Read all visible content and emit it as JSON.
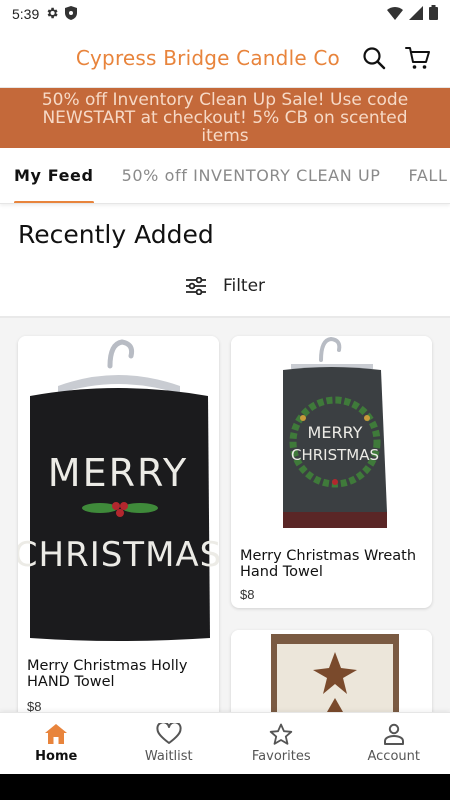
{
  "status_bar": {
    "time": "5:39"
  },
  "header": {
    "title": "Cypress Bridge Candle Co",
    "accent": "#e8843c"
  },
  "promo": {
    "text": "50% off Inventory Clean Up Sale! Use code NEWSTART at checkout! 5% CB on scented items",
    "bg": "#c4693a"
  },
  "tabs": [
    {
      "label": "My Feed"
    },
    {
      "label": "50% off INVENTORY CLEAN UP"
    },
    {
      "label": "FALL SCENTS"
    }
  ],
  "section": {
    "title": "Recently Added",
    "filter_label": "Filter"
  },
  "products": [
    {
      "name": "Merry Christmas Holly HAND Towel",
      "price": "$8"
    },
    {
      "name": "Merry Christmas Wreath Hand Towel",
      "price": "$8"
    },
    {
      "name": "",
      "price": ""
    }
  ],
  "nav": [
    {
      "label": "Home",
      "icon": "home-icon"
    },
    {
      "label": "Waitlist",
      "icon": "heart-icon"
    },
    {
      "label": "Favorites",
      "icon": "star-icon"
    },
    {
      "label": "Account",
      "icon": "account-icon"
    }
  ]
}
